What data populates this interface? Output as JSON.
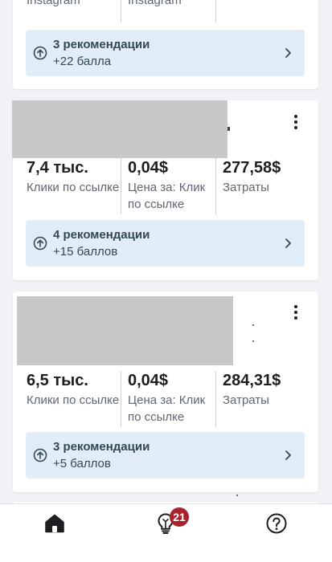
{
  "cards": [
    {
      "metrics": [
        {
          "value": "",
          "label": "Instagram"
        },
        {
          "value": "",
          "label": "профиля Instagram"
        },
        {
          "value": "",
          "label": ""
        }
      ],
      "recommendation": {
        "title": "3 рекомендации",
        "points": "+22 балла"
      }
    },
    {
      "metrics": [
        {
          "value": "7,4 тыс.",
          "label": "Клики по ссылке"
        },
        {
          "value": "0,04$",
          "label": "Цена за: Клик по ссылке"
        },
        {
          "value": "277,58$",
          "label": "Затраты"
        }
      ],
      "recommendation": {
        "title": "4 рекомендации",
        "points": "+15 баллов"
      }
    },
    {
      "metrics": [
        {
          "value": "6,5 тыс.",
          "label": "Клики по ссылке"
        },
        {
          "value": "0,04$",
          "label": "Цена за: Клик по ссылке"
        },
        {
          "value": "284,31$",
          "label": "Затраты"
        }
      ],
      "recommendation": {
        "title": "3 рекомендации",
        "points": "+5 баллов"
      }
    }
  ],
  "bottom_nav": {
    "items": [
      {
        "icon": "home-icon"
      },
      {
        "icon": "lightbulb-icon",
        "badge": "21"
      },
      {
        "icon": "help-icon"
      }
    ]
  },
  "colors": {
    "accent": "#344854",
    "recommendation_bg": "#e1edf7",
    "badge": "#a8232d",
    "page_bg": "#f0f2f5"
  }
}
